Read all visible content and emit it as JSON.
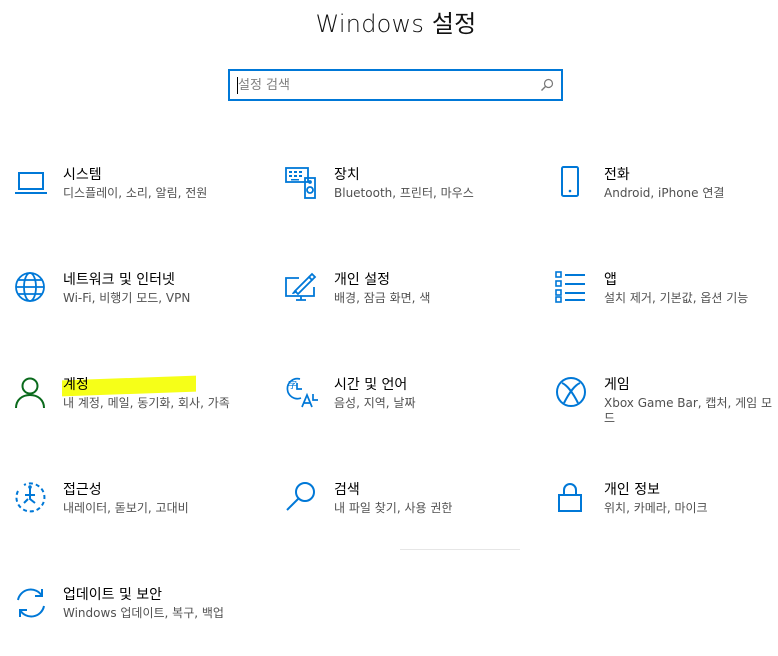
{
  "header": {
    "title": "Windows 설정"
  },
  "search": {
    "placeholder": "설정 검색",
    "icon": "search-icon"
  },
  "colors": {
    "accent": "#0078d7",
    "highlight": "#f6ff0c"
  },
  "tiles": [
    {
      "label": "시스템",
      "desc": "디스플레이, 소리, 알림, 전원",
      "icon": "laptop-icon"
    },
    {
      "label": "장치",
      "desc": "Bluetooth, 프린터, 마우스",
      "icon": "keyboard-speaker-icon"
    },
    {
      "label": "전화",
      "desc": "Android, iPhone 연결",
      "icon": "phone-icon"
    },
    {
      "label": "네트워크 및 인터넷",
      "desc": "Wi-Fi, 비행기 모드, VPN",
      "icon": "globe-icon"
    },
    {
      "label": "개인 설정",
      "desc": "배경, 잠금 화면, 색",
      "icon": "brush-monitor-icon"
    },
    {
      "label": "앱",
      "desc": "설치 제거, 기본값, 옵션 기능",
      "icon": "apps-list-icon"
    },
    {
      "label": "계정",
      "desc": "내 계정, 메일, 동기화, 회사, 가족",
      "icon": "person-icon"
    },
    {
      "label": "시간 및 언어",
      "desc": "음성, 지역, 날짜",
      "icon": "time-language-icon"
    },
    {
      "label": "게임",
      "desc": "Xbox Game Bar, 캡처, 게임 모드",
      "icon": "xbox-icon"
    },
    {
      "label": "접근성",
      "desc": "내레이터, 돋보기, 고대비",
      "icon": "ease-of-access-icon"
    },
    {
      "label": "검색",
      "desc": "내 파일 찾기, 사용 권한",
      "icon": "magnifier-icon"
    },
    {
      "label": "개인 정보",
      "desc": "위치, 카메라, 마이크",
      "icon": "lock-icon"
    },
    {
      "label": "업데이트 및 보안",
      "desc": "Windows 업데이트, 복구, 백업",
      "icon": "sync-arrows-icon"
    }
  ]
}
